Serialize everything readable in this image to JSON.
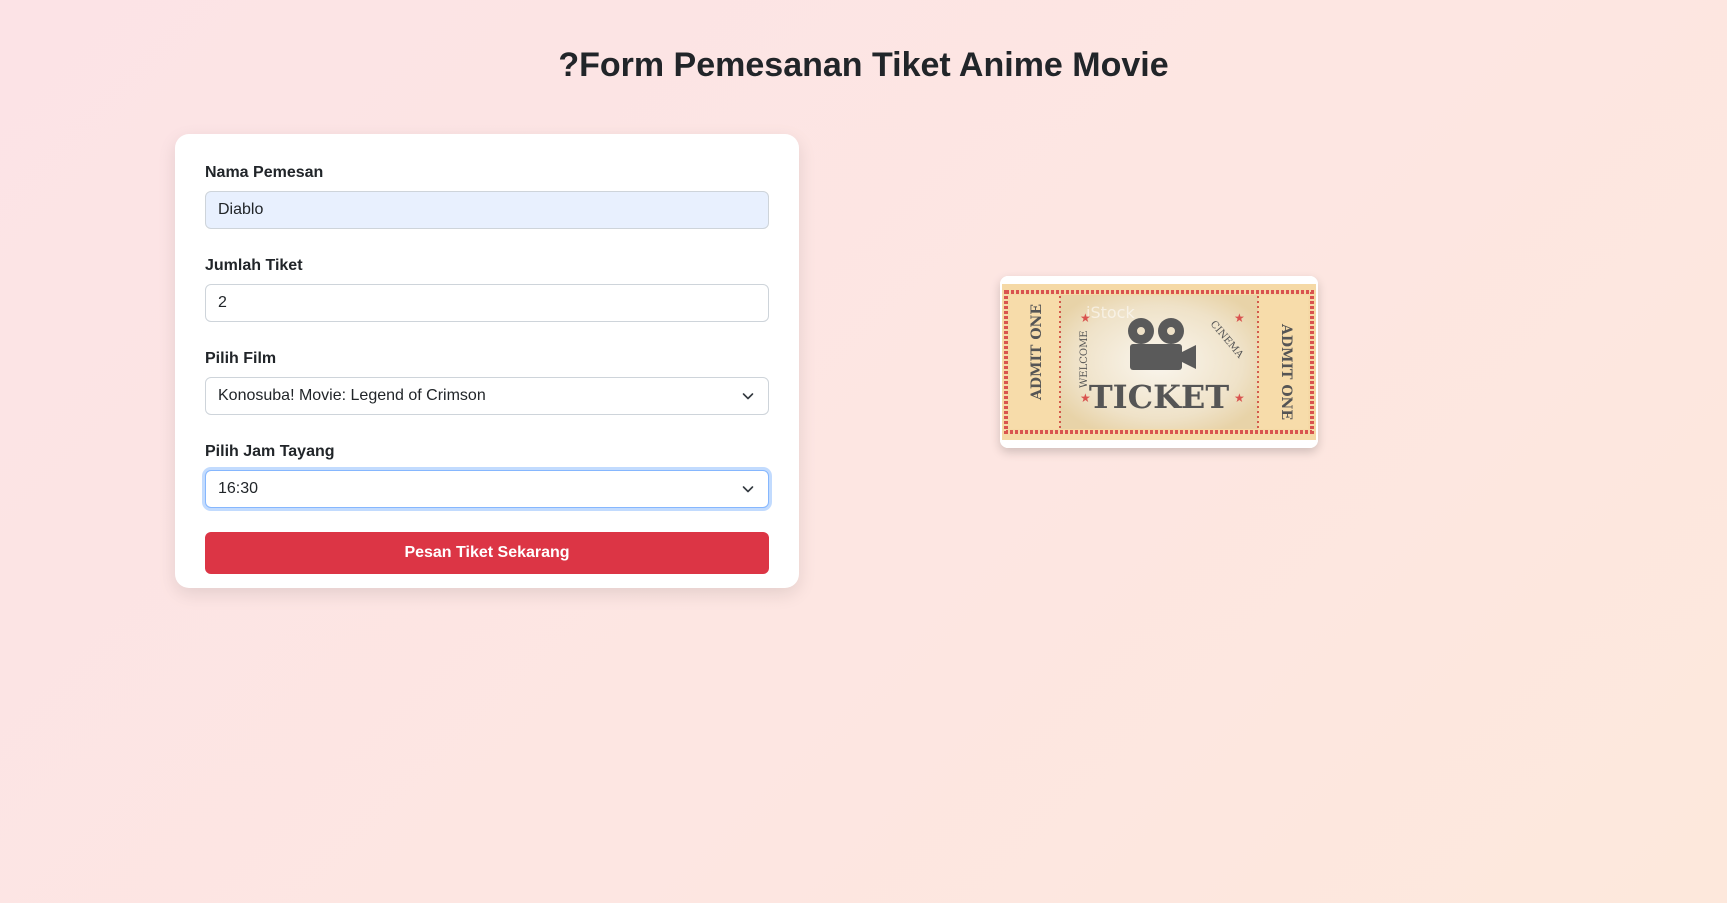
{
  "page": {
    "title": "?Form Pemesanan Tiket Anime Movie"
  },
  "form": {
    "nama": {
      "label": "Nama Pemesan",
      "value": "Diablo"
    },
    "jumlah": {
      "label": "Jumlah Tiket",
      "value": "2"
    },
    "film": {
      "label": "Pilih Film",
      "value": "Konosuba! Movie: Legend of Crimson"
    },
    "jam": {
      "label": "Pilih Jam Tayang",
      "value": "16:30"
    },
    "submit_label": "Pesan Tiket Sekarang"
  },
  "ticket_image": {
    "main_text": "TICKET",
    "admit_left": "ADMIT ONE",
    "admit_right": "ADMIT ONE",
    "welcome": "WELCOME",
    "cinema": "CINEMA",
    "watermark": "iStock",
    "colors": {
      "paper": "#f5d9a6",
      "border": "#d9534f",
      "ink": "#555555"
    }
  },
  "colors": {
    "accent": "#dc3545",
    "focus": "#86b7fe",
    "autofill": "#e8f0fe"
  }
}
